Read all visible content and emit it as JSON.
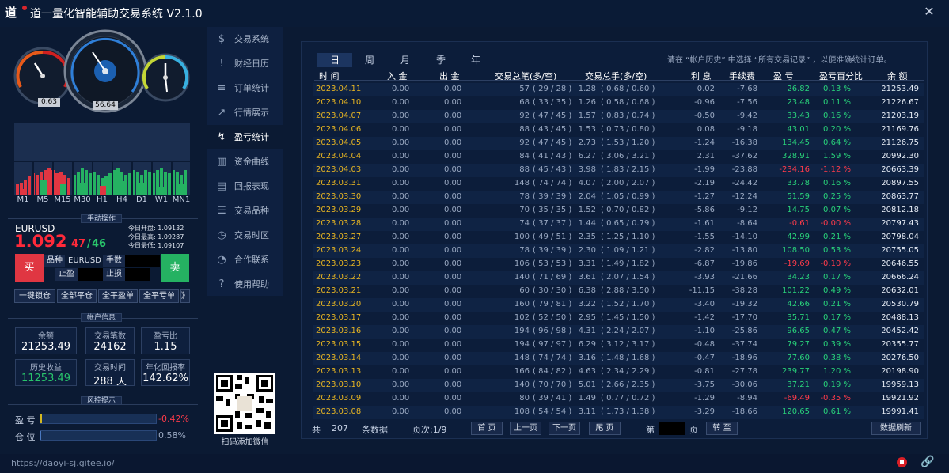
{
  "window": {
    "title": "道一量化智能辅助交易系统 V2.1.0",
    "logo_text": "道"
  },
  "gauges": {
    "left_value": "0.63",
    "center_value": "56.64"
  },
  "timeframes": [
    "M1",
    "M5",
    "M15",
    "M30",
    "H1",
    "H4",
    "D1",
    "W1",
    "MN1"
  ],
  "manual": {
    "section_title": "手动操作",
    "symbol": "EURUSD",
    "price_main": "1.092",
    "price_small": "47",
    "price_slash": "/",
    "price_small2": "46",
    "open_label": "今日开盘: 1.09132",
    "high_label": "今日最高: 1.09287",
    "low_label": "今日最低: 1.09107",
    "buy_label": "买",
    "sell_label": "卖",
    "symbol_label": "品种",
    "symbol_value": "EURUSD",
    "lots_label": "手数",
    "tp_label": "止盈",
    "sl_label": "止损",
    "lock_all": "一键锁仓",
    "close_all": "全部平仓",
    "close_profit": "全平盈单",
    "close_loss": "全平亏单",
    "more": "》"
  },
  "account": {
    "section_title": "帐户信息",
    "balance_label": "余额",
    "balance": "21253.49",
    "trades_label": "交易笔数",
    "trades": "24162",
    "pl_ratio_label": "盈亏比",
    "pl_ratio": "1.15",
    "hist_label": "历史收益",
    "hist": "11253.49",
    "time_label": "交易时间",
    "time": "288 天",
    "annual_label": "年化回报率",
    "annual": "142.62%"
  },
  "risk": {
    "section_title": "风控提示",
    "pl_label": "盈 亏",
    "pl_value": "-0.42%",
    "pos_label": "仓 位",
    "pos_value": "0.58%"
  },
  "nav": [
    {
      "label": "交易系统",
      "icon": "$"
    },
    {
      "label": "财经日历",
      "icon": "!"
    },
    {
      "label": "订单统计",
      "icon": "≡"
    },
    {
      "label": "行情展示",
      "icon": "↗"
    },
    {
      "label": "盈亏统计",
      "icon": "↯"
    },
    {
      "label": "资金曲线",
      "icon": "▥"
    },
    {
      "label": "回报表现",
      "icon": "▤"
    },
    {
      "label": "交易品种",
      "icon": "☰"
    },
    {
      "label": "交易时区",
      "icon": "◷"
    },
    {
      "label": "合作联系",
      "icon": "◔"
    },
    {
      "label": "使用帮助",
      "icon": "?"
    }
  ],
  "qr_label": "扫码添加微信",
  "period_tabs": [
    "日",
    "周",
    "月",
    "季",
    "年"
  ],
  "hint": "请在 “帐户历史” 中选择 “所有交易记录” ，以便准确统计订单。",
  "columns": [
    "时 间",
    "入 金",
    "出 金",
    "交易总笔(多/空)",
    "交易总手(多/空)",
    "利 息",
    "手续费",
    "盈 亏",
    "盈亏百分比",
    "余 额"
  ],
  "rows": [
    [
      "2023.04.11",
      "0.00",
      "0.00",
      "57",
      "( 29 / 28 )",
      "1.28",
      "( 0.68 / 0.60 )",
      "0.02",
      "-7.68",
      "26.82",
      "0.13 %",
      "21253.49"
    ],
    [
      "2023.04.10",
      "0.00",
      "0.00",
      "68",
      "( 33 / 35 )",
      "1.26",
      "( 0.58 / 0.68 )",
      "-0.96",
      "-7.56",
      "23.48",
      "0.11 %",
      "21226.67"
    ],
    [
      "2023.04.07",
      "0.00",
      "0.00",
      "92",
      "( 47 / 45 )",
      "1.57",
      "( 0.83 / 0.74 )",
      "-0.50",
      "-9.42",
      "33.43",
      "0.16 %",
      "21203.19"
    ],
    [
      "2023.04.06",
      "0.00",
      "0.00",
      "88",
      "( 43 / 45 )",
      "1.53",
      "( 0.73 / 0.80 )",
      "0.08",
      "-9.18",
      "43.01",
      "0.20 %",
      "21169.76"
    ],
    [
      "2023.04.05",
      "0.00",
      "0.00",
      "92",
      "( 47 / 45 )",
      "2.73",
      "( 1.53 / 1.20 )",
      "-1.24",
      "-16.38",
      "134.45",
      "0.64 %",
      "21126.75"
    ],
    [
      "2023.04.04",
      "0.00",
      "0.00",
      "84",
      "( 41 / 43 )",
      "6.27",
      "( 3.06 / 3.21 )",
      "2.31",
      "-37.62",
      "328.91",
      "1.59 %",
      "20992.30"
    ],
    [
      "2023.04.03",
      "0.00",
      "0.00",
      "88",
      "( 45 / 43 )",
      "3.98",
      "( 1.83 / 2.15 )",
      "-1.99",
      "-23.88",
      "-234.16",
      "-1.12 %",
      "20663.39"
    ],
    [
      "2023.03.31",
      "0.00",
      "0.00",
      "148",
      "( 74 / 74 )",
      "4.07",
      "( 2.00 / 2.07 )",
      "-2.19",
      "-24.42",
      "33.78",
      "0.16 %",
      "20897.55"
    ],
    [
      "2023.03.30",
      "0.00",
      "0.00",
      "78",
      "( 39 / 39 )",
      "2.04",
      "( 1.05 / 0.99 )",
      "-1.27",
      "-12.24",
      "51.59",
      "0.25 %",
      "20863.77"
    ],
    [
      "2023.03.29",
      "0.00",
      "0.00",
      "70",
      "( 35 / 35 )",
      "1.52",
      "( 0.70 / 0.82 )",
      "-5.86",
      "-9.12",
      "14.75",
      "0.07 %",
      "20812.18"
    ],
    [
      "2023.03.28",
      "0.00",
      "0.00",
      "74",
      "( 37 / 37 )",
      "1.44",
      "( 0.65 / 0.79 )",
      "-1.61",
      "-8.64",
      "-0.61",
      "-0.00 %",
      "20797.43"
    ],
    [
      "2023.03.27",
      "0.00",
      "0.00",
      "100",
      "( 49 / 51 )",
      "2.35",
      "( 1.25 / 1.10 )",
      "-1.55",
      "-14.10",
      "42.99",
      "0.21 %",
      "20798.04"
    ],
    [
      "2023.03.24",
      "0.00",
      "0.00",
      "78",
      "( 39 / 39 )",
      "2.30",
      "( 1.09 / 1.21 )",
      "-2.82",
      "-13.80",
      "108.50",
      "0.53 %",
      "20755.05"
    ],
    [
      "2023.03.23",
      "0.00",
      "0.00",
      "106",
      "( 53 / 53 )",
      "3.31",
      "( 1.49 / 1.82 )",
      "-6.87",
      "-19.86",
      "-19.69",
      "-0.10 %",
      "20646.55"
    ],
    [
      "2023.03.22",
      "0.00",
      "0.00",
      "140",
      "( 71 / 69 )",
      "3.61",
      "( 2.07 / 1.54 )",
      "-3.93",
      "-21.66",
      "34.23",
      "0.17 %",
      "20666.24"
    ],
    [
      "2023.03.21",
      "0.00",
      "0.00",
      "60",
      "( 30 / 30 )",
      "6.38",
      "( 2.88 / 3.50 )",
      "-11.15",
      "-38.28",
      "101.22",
      "0.49 %",
      "20632.01"
    ],
    [
      "2023.03.20",
      "0.00",
      "0.00",
      "160",
      "( 79 / 81 )",
      "3.22",
      "( 1.52 / 1.70 )",
      "-3.40",
      "-19.32",
      "42.66",
      "0.21 %",
      "20530.79"
    ],
    [
      "2023.03.17",
      "0.00",
      "0.00",
      "102",
      "( 52 / 50 )",
      "2.95",
      "( 1.45 / 1.50 )",
      "-1.42",
      "-17.70",
      "35.71",
      "0.17 %",
      "20488.13"
    ],
    [
      "2023.03.16",
      "0.00",
      "0.00",
      "194",
      "( 96 / 98 )",
      "4.31",
      "( 2.24 / 2.07 )",
      "-1.10",
      "-25.86",
      "96.65",
      "0.47 %",
      "20452.42"
    ],
    [
      "2023.03.15",
      "0.00",
      "0.00",
      "194",
      "( 97 / 97 )",
      "6.29",
      "( 3.12 / 3.17 )",
      "-0.48",
      "-37.74",
      "79.27",
      "0.39 %",
      "20355.77"
    ],
    [
      "2023.03.14",
      "0.00",
      "0.00",
      "148",
      "( 74 / 74 )",
      "3.16",
      "( 1.48 / 1.68 )",
      "-0.47",
      "-18.96",
      "77.60",
      "0.38 %",
      "20276.50"
    ],
    [
      "2023.03.13",
      "0.00",
      "0.00",
      "166",
      "( 84 / 82 )",
      "4.63",
      "( 2.34 / 2.29 )",
      "-0.81",
      "-27.78",
      "239.77",
      "1.20 %",
      "20198.90"
    ],
    [
      "2023.03.10",
      "0.00",
      "0.00",
      "140",
      "( 70 / 70 )",
      "5.01",
      "( 2.66 / 2.35 )",
      "-3.75",
      "-30.06",
      "37.21",
      "0.19 %",
      "19959.13"
    ],
    [
      "2023.03.09",
      "0.00",
      "0.00",
      "80",
      "( 39 / 41 )",
      "1.49",
      "( 0.77 / 0.72 )",
      "-1.29",
      "-8.94",
      "-69.49",
      "-0.35 %",
      "19921.92"
    ],
    [
      "2023.03.08",
      "0.00",
      "0.00",
      "108",
      "( 54 / 54 )",
      "3.11",
      "( 1.73 / 1.38 )",
      "-3.29",
      "-18.66",
      "120.65",
      "0.61 %",
      "19991.41"
    ]
  ],
  "footer": {
    "total_label": "共",
    "total": "207",
    "records_label": "条数据",
    "page_info": "页次:1/9",
    "first": "首 页",
    "prev": "上一页",
    "next": "下一页",
    "last": "尾 页",
    "goto_prefix": "第",
    "goto_suffix": "页",
    "goto": "转 至",
    "refresh": "数据刷新"
  },
  "status": {
    "url": "https://daoyi-sj.gitee.io/"
  },
  "colors": {
    "bg": "#0b1a33",
    "date": "#e6b422",
    "profit": "#29d27a",
    "loss": "#ff3b4a",
    "buy": "#e03642",
    "sell": "#25b262"
  }
}
